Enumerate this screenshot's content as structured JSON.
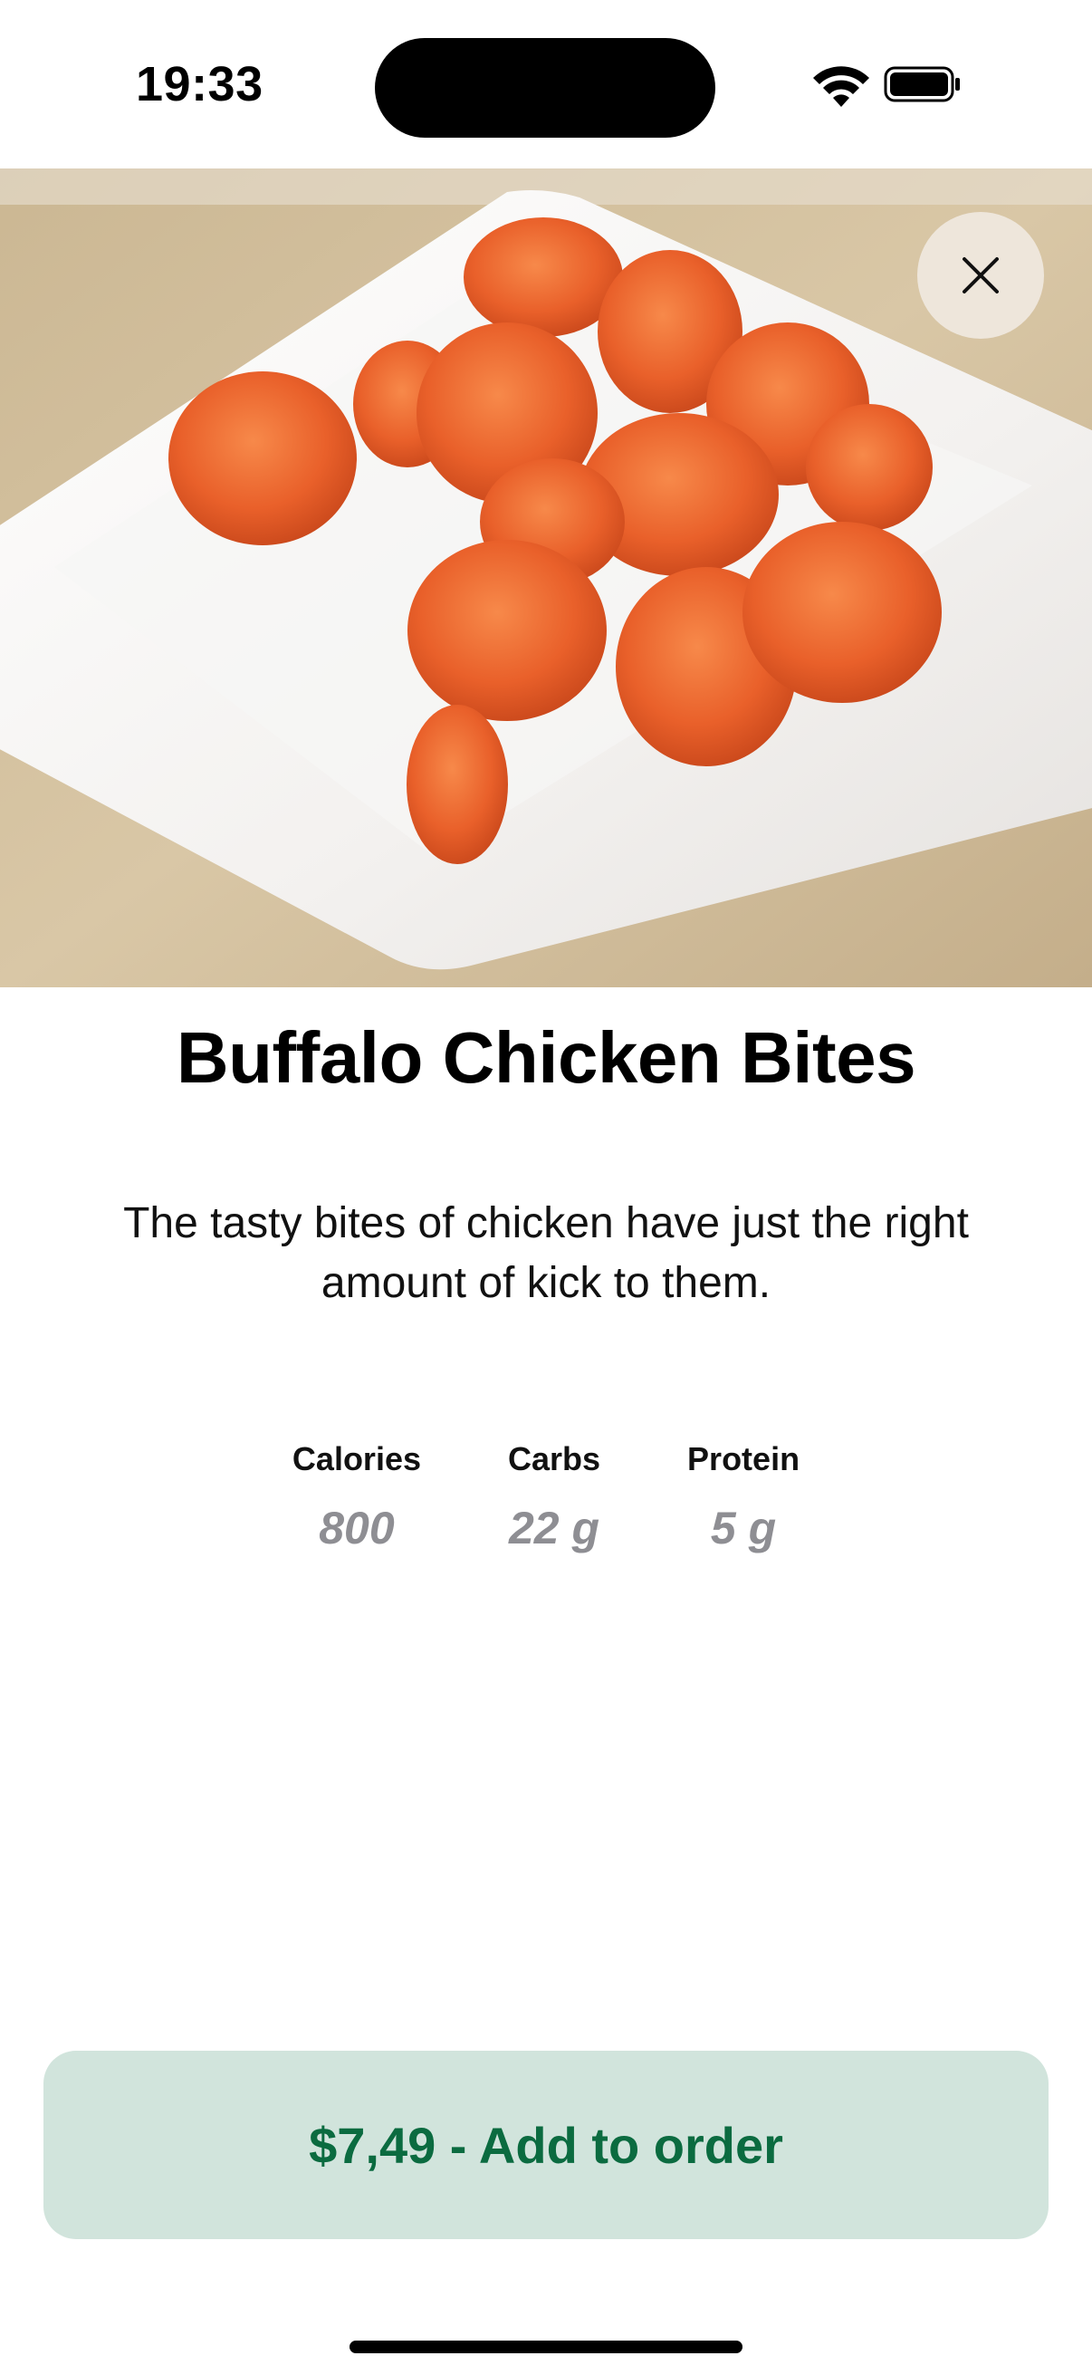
{
  "status_bar": {
    "time": "19:33",
    "icons": [
      "wifi-icon",
      "battery-icon"
    ]
  },
  "hero": {
    "image": "buffalo-chicken-bites-photo",
    "close_icon": "close-icon"
  },
  "product": {
    "title": "Buffalo Chicken Bites",
    "description": "The tasty bites of chicken have just the right amount of kick to them."
  },
  "nutrition": [
    {
      "label": "Calories",
      "value": "800"
    },
    {
      "label": "Carbs",
      "value": "22 g"
    },
    {
      "label": "Protein",
      "value": "5 g"
    }
  ],
  "order_button": {
    "label": "$7,49 - Add to order"
  },
  "colors": {
    "accent": "#0b6b40",
    "button_background": "#d1e4dc",
    "muted_value": "#8e8e93"
  }
}
